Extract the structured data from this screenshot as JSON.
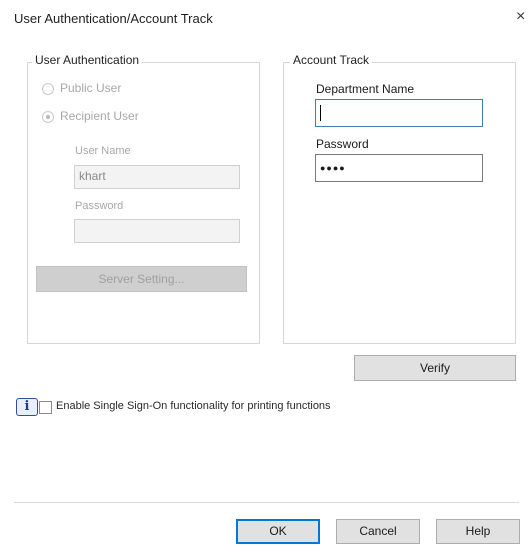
{
  "window": {
    "title": "User Authentication/Account Track",
    "close_glyph": "×"
  },
  "user_auth": {
    "legend": "User Authentication",
    "public_user_label": "Public User",
    "recipient_user_label": "Recipient User",
    "user_name_label": "User Name",
    "user_name_value": "khart",
    "password_label": "Password",
    "password_value": "",
    "server_setting_label": "Server Setting..."
  },
  "account_track": {
    "legend": "Account Track",
    "department_name_label": "Department Name",
    "department_name_value": "",
    "password_label": "Password",
    "password_value": "●●●●",
    "verify_label": "Verify"
  },
  "sso": {
    "icon": "i",
    "label": "Enable Single Sign-On functionality for printing functions"
  },
  "footer": {
    "ok_label": "OK",
    "cancel_label": "Cancel",
    "help_label": "Help"
  }
}
